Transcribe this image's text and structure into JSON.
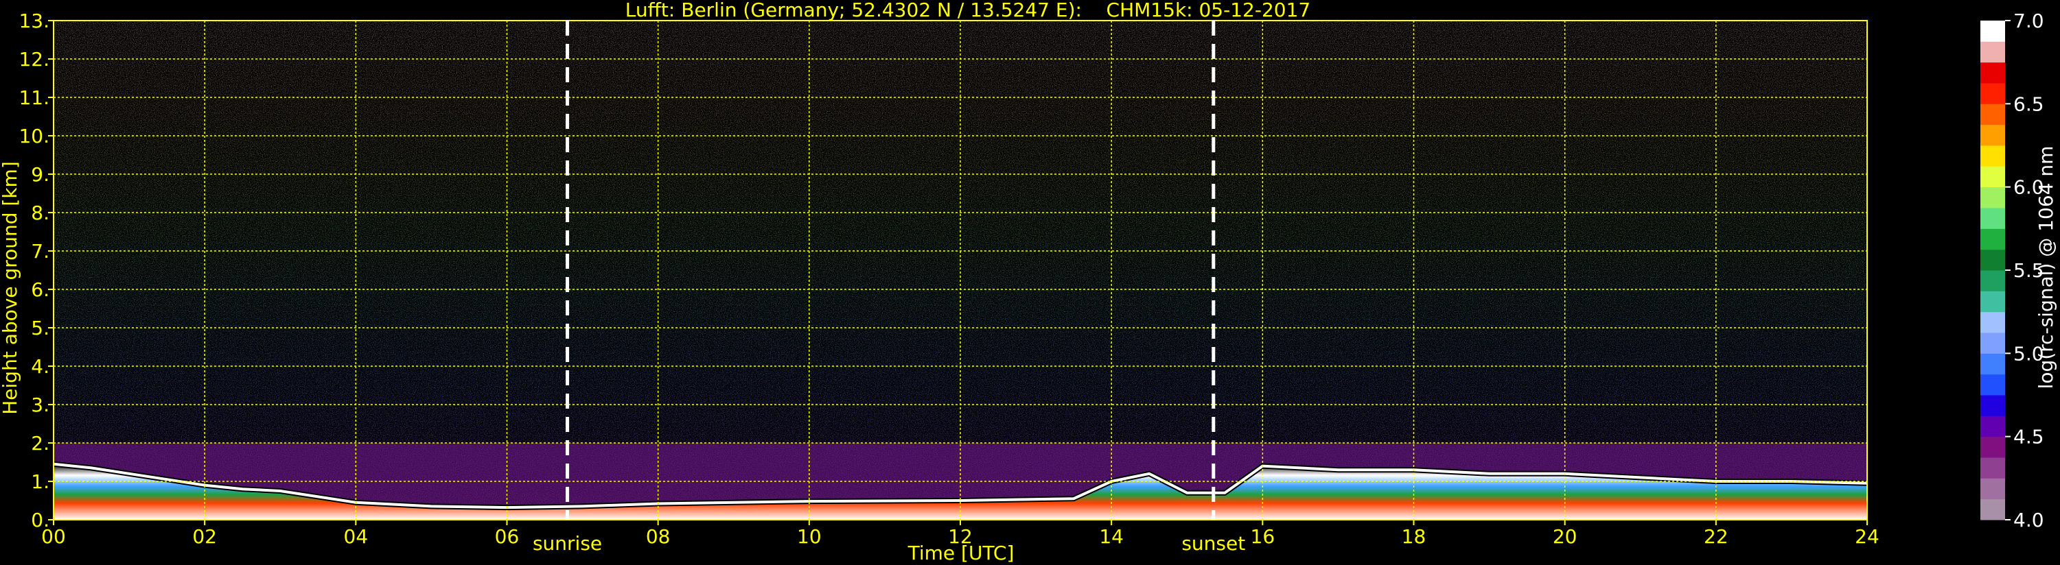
{
  "chart_data": {
    "type": "heatmap",
    "title": "Lufft: Berlin (Germany; 52.4302 N / 13.5247 E):    CHM15k: 05-12-2017",
    "xlabel": "Time [UTC]",
    "ylabel": "Height above ground [km]",
    "xlim": [
      0,
      24
    ],
    "ylim": [
      0,
      13
    ],
    "x_ticks": [
      0,
      2,
      4,
      6,
      8,
      10,
      12,
      14,
      16,
      18,
      20,
      22,
      24
    ],
    "x_tick_labels": [
      "00",
      "02",
      "04",
      "06",
      "08",
      "10",
      "12",
      "14",
      "16",
      "18",
      "20",
      "22",
      "24"
    ],
    "y_ticks": [
      0,
      1,
      2,
      3,
      4,
      5,
      6,
      7,
      8,
      9,
      10,
      11,
      12,
      13
    ],
    "y_tick_labels": [
      "0.",
      "1.",
      "2.",
      "3.",
      "4.",
      "5.",
      "6.",
      "7.",
      "8.",
      "9.",
      "10.",
      "11.",
      "12.",
      "13."
    ],
    "grid": true,
    "markers": [
      {
        "label": "sunrise",
        "x": 6.8
      },
      {
        "label": "sunset",
        "x": 15.35
      }
    ],
    "colorbar": {
      "label": "log(rc-signal) @ 1064 nm",
      "min": 4.0,
      "max": 7.0,
      "ticks": [
        4.0,
        4.5,
        5.0,
        5.5,
        6.0,
        6.5,
        7.0
      ],
      "tick_labels": [
        "4.0",
        "4.5",
        "5.0",
        "5.5",
        "6.0",
        "6.5",
        "7.0"
      ],
      "colors": [
        "#a890a8",
        "#a070a0",
        "#904090",
        "#801080",
        "#6000b0",
        "#2000e0",
        "#2050ff",
        "#4080ff",
        "#80a0ff",
        "#a0c0ff",
        "#40c0a0",
        "#20a060",
        "#108030",
        "#20b040",
        "#60e080",
        "#a0f060",
        "#e0ff40",
        "#ffe000",
        "#ffa000",
        "#ff6000",
        "#ff2000",
        "#e80000",
        "#f0b0b0",
        "#ffffff"
      ]
    },
    "boundary_layer_top_km": [
      [
        0,
        1.45
      ],
      [
        0.5,
        1.35
      ],
      [
        1,
        1.2
      ],
      [
        1.5,
        1.05
      ],
      [
        2,
        0.9
      ],
      [
        2.5,
        0.8
      ],
      [
        3,
        0.75
      ],
      [
        3.5,
        0.6
      ],
      [
        4,
        0.45
      ],
      [
        5,
        0.35
      ],
      [
        6,
        0.32
      ],
      [
        7,
        0.35
      ],
      [
        8,
        0.42
      ],
      [
        10,
        0.48
      ],
      [
        12,
        0.5
      ],
      [
        13.5,
        0.55
      ],
      [
        14,
        1.0
      ],
      [
        14.5,
        1.2
      ],
      [
        15,
        0.7
      ],
      [
        15.5,
        0.7
      ],
      [
        16,
        1.4
      ],
      [
        17,
        1.3
      ],
      [
        18,
        1.3
      ],
      [
        19,
        1.2
      ],
      [
        20,
        1.2
      ],
      [
        21,
        1.1
      ],
      [
        22,
        1.0
      ],
      [
        23,
        1.0
      ],
      [
        24,
        0.95
      ]
    ]
  },
  "colors": {
    "text": "#ffff00",
    "background": "#000000",
    "grid": "#ffff00",
    "markers": "#ffffff"
  }
}
